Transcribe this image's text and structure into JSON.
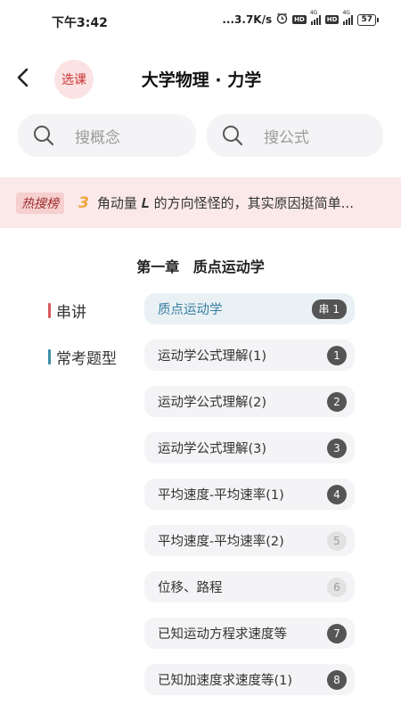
{
  "status_bar": {
    "time": "下午3:42",
    "network_speed": "...3.7K/s",
    "hd": "HD",
    "net_type": "4G",
    "battery": "57"
  },
  "header": {
    "title": "大学物理 · 力学",
    "course_select_label": "选课"
  },
  "search": {
    "concept_placeholder": "搜概念",
    "formula_placeholder": "搜公式"
  },
  "hot": {
    "tag": "热搜榜",
    "rank": "3",
    "text": "角动量 𝑳 的方向怪怪的，其实原因挺简单..."
  },
  "chapter": {
    "title": "第一章 质点运动学"
  },
  "left_nav": [
    {
      "label": "串讲",
      "color": "#d85a5a"
    },
    {
      "label": "常考题型",
      "color": "#3e8fa8"
    }
  ],
  "lessons": [
    {
      "label": "质点运动学",
      "badge": "串 1",
      "active": true,
      "muted": false
    },
    {
      "label": "运动学公式理解(1)",
      "badge": "1",
      "active": false,
      "muted": false
    },
    {
      "label": "运动学公式理解(2)",
      "badge": "2",
      "active": false,
      "muted": false
    },
    {
      "label": "运动学公式理解(3)",
      "badge": "3",
      "active": false,
      "muted": false
    },
    {
      "label": "平均速度-平均速率(1)",
      "badge": "4",
      "active": false,
      "muted": false
    },
    {
      "label": "平均速度-平均速率(2)",
      "badge": "5",
      "active": false,
      "muted": true
    },
    {
      "label": "位移、路程",
      "badge": "6",
      "active": false,
      "muted": true
    },
    {
      "label": "已知运动方程求速度等",
      "badge": "7",
      "active": false,
      "muted": false
    },
    {
      "label": "已知加速度求速度等(1)",
      "badge": "8",
      "active": false,
      "muted": false
    }
  ],
  "colors": {
    "accent_red": "#c33333",
    "active_blue": "#3a7fa2",
    "hot_rank": "#f2a43a"
  }
}
